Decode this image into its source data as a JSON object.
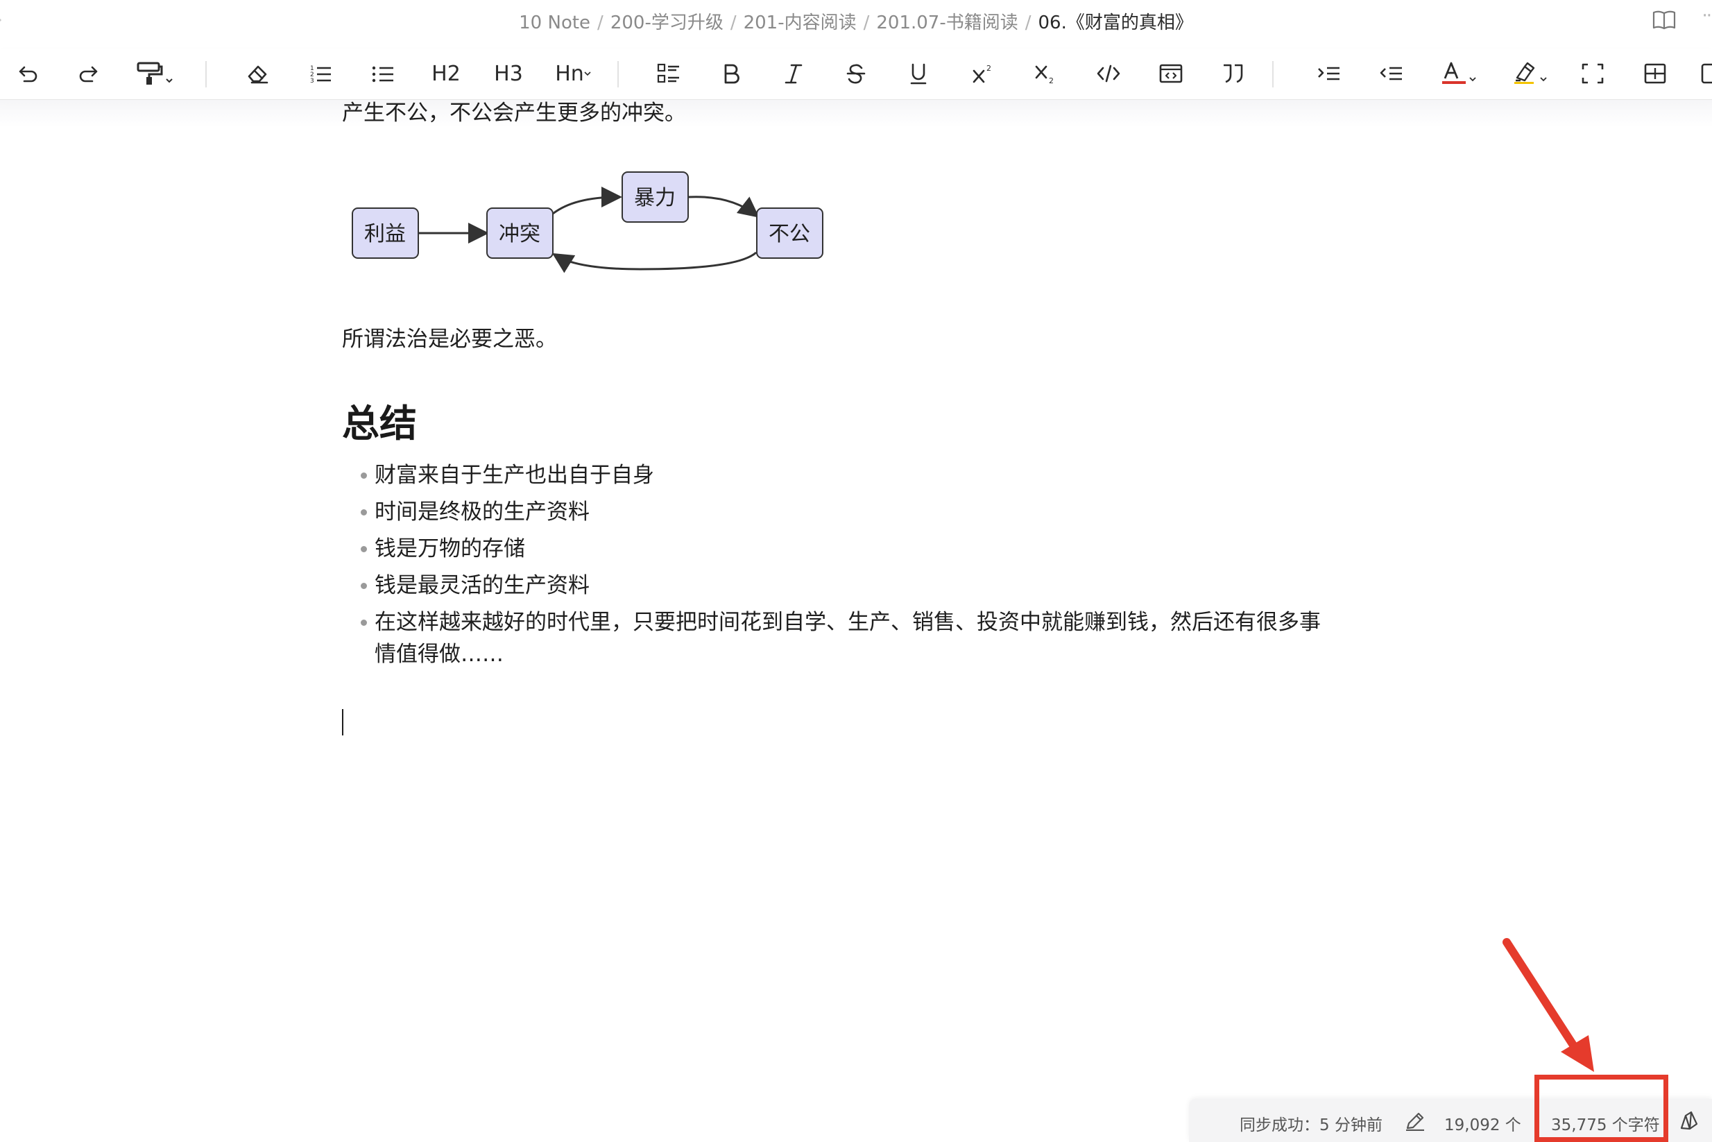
{
  "breadcrumb": {
    "items": [
      "10 Note",
      "200-学习升级",
      "201-内容阅读",
      "201.07-书籍阅读"
    ],
    "current": "06.《财富的真相》",
    "separator": "/"
  },
  "toolbar": {
    "h2": "H2",
    "h3": "H3",
    "hn": "Hn",
    "font_color": "#d9342b",
    "buttons": [
      "undo-icon",
      "redo-icon",
      "format-painter-icon",
      "eraser-icon",
      "ordered-list-icon",
      "bullet-list-icon",
      "h2",
      "h3",
      "hn",
      "checklist-icon",
      "bold-icon",
      "italic-icon",
      "strikethrough-icon",
      "underline-icon",
      "superscript-icon",
      "subscript-icon",
      "code-icon",
      "code-block-icon",
      "quote-icon",
      "indent-icon",
      "outdent-icon",
      "font-color-icon",
      "highlight-icon",
      "fullscreen-icon",
      "table-icon"
    ]
  },
  "document": {
    "para_top": "产生不公，不公会产生更多的冲突。",
    "diagram": {
      "nodes": [
        "利益",
        "冲突",
        "暴力",
        "不公"
      ],
      "node_fill": "#dcdcf7",
      "node_stroke": "#333333"
    },
    "para_law": "所谓法治是必要之恶。",
    "heading": "总结",
    "list": [
      "财富来自于生产也出自于自身",
      "时间是终极的生产资料",
      "钱是万物的存储",
      "钱是最灵活的生产资料",
      "在这样越来越好的时代里，只要把时间花到自学、生产、销售、投资中就能赚到钱，然后还有很多事情值得做……"
    ]
  },
  "status": {
    "sync": "同步成功：5 分钟前",
    "words": "19,092 个词",
    "chars": "35,775 个字符"
  },
  "annotation": {
    "color": "#e53b2c"
  }
}
